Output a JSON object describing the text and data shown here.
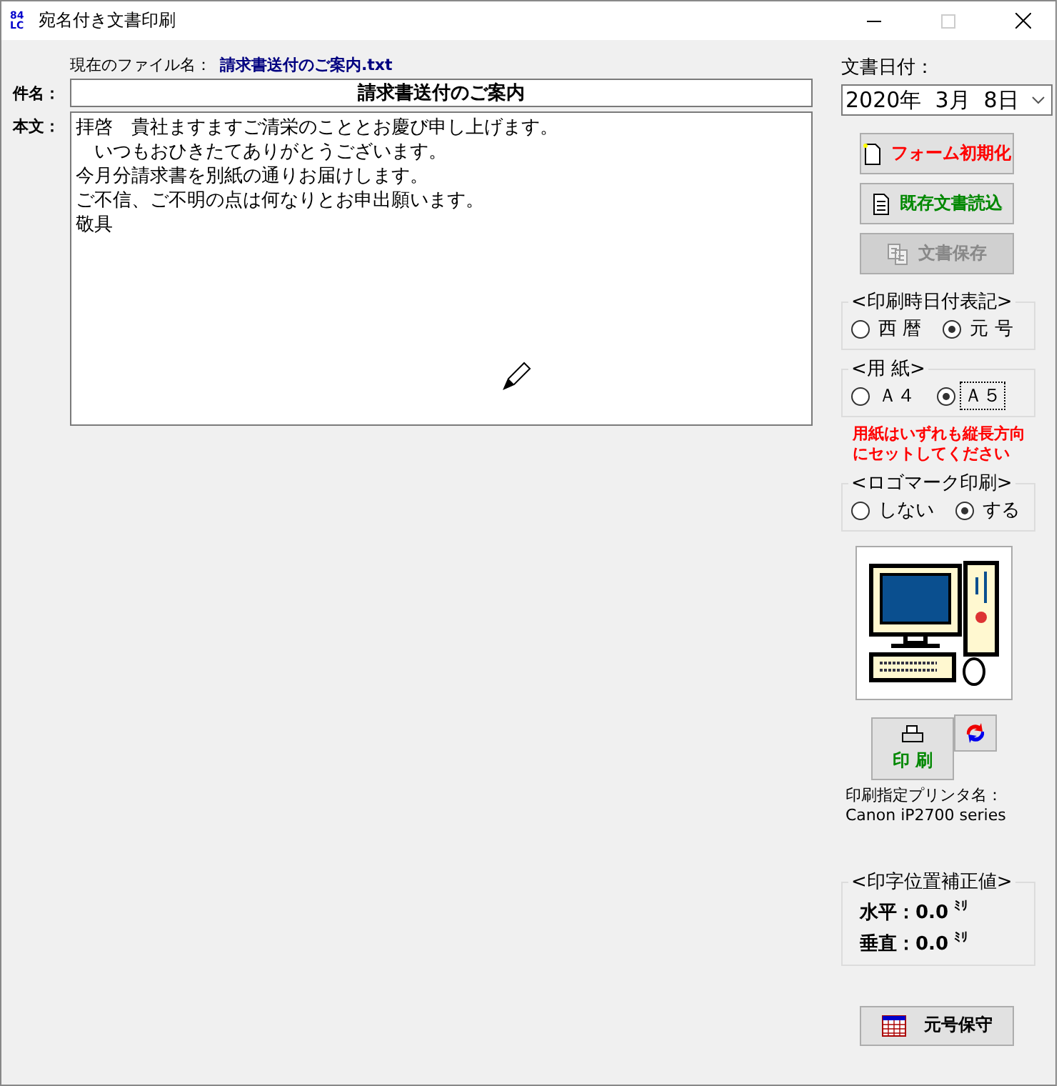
{
  "window": {
    "title": "宛名付き文書印刷",
    "app_icon_text": "84LC"
  },
  "file": {
    "label": "現在のファイル名：",
    "value": "請求書送付のご案内.txt"
  },
  "subject": {
    "label": "件名：",
    "value": "請求書送付のご案内"
  },
  "body": {
    "label": "本文：",
    "lines": [
      "拝啓　貴社ますますご清栄のこととお慶び申し上げます。",
      "　いつもおひきたてありがとうございます。",
      "今月分請求書を別紙の通りお届けします。",
      "ご不信、ご不明の点は何なりとお申出願います。",
      "敬具"
    ]
  },
  "date": {
    "label": "文書日付：",
    "value": "2020年  3月  8日"
  },
  "action_buttons": [
    {
      "label": "フォーム初期化",
      "kind": "reset",
      "disabled": false
    },
    {
      "label": "既存文書読込",
      "kind": "open",
      "disabled": false
    },
    {
      "label": "文書保存",
      "kind": "save",
      "disabled": true
    }
  ],
  "date_format_group": {
    "title": "<印刷時日付表記>",
    "options": [
      {
        "label": "西 暦",
        "selected": false,
        "focused": false
      },
      {
        "label": "元 号",
        "selected": true,
        "focused": false
      }
    ]
  },
  "paper_group": {
    "title": "<用  紙>",
    "options": [
      {
        "label": "Ａ４",
        "selected": false,
        "focused": false
      },
      {
        "label": "Ａ５",
        "selected": true,
        "focused": true
      }
    ]
  },
  "paper_note": "用紙はいずれも縦長方向にセットしてください",
  "logo_group": {
    "title": "<ロゴマーク印刷>",
    "options": [
      {
        "label": "しない",
        "selected": false,
        "focused": false
      },
      {
        "label": "する",
        "selected": true,
        "focused": false
      }
    ]
  },
  "print_button": {
    "label": "印 刷"
  },
  "printer": {
    "label": "印刷指定プリンタ名：",
    "value": "Canon iP2700 series"
  },
  "offset_group": {
    "title": "<印字位置補正値>",
    "rows": [
      {
        "label": "水平：0.0",
        "unit": "ﾐﾘ"
      },
      {
        "label": "垂直：0.0",
        "unit": "ﾐﾘ"
      }
    ]
  },
  "era_button": {
    "label": "元号保守"
  }
}
